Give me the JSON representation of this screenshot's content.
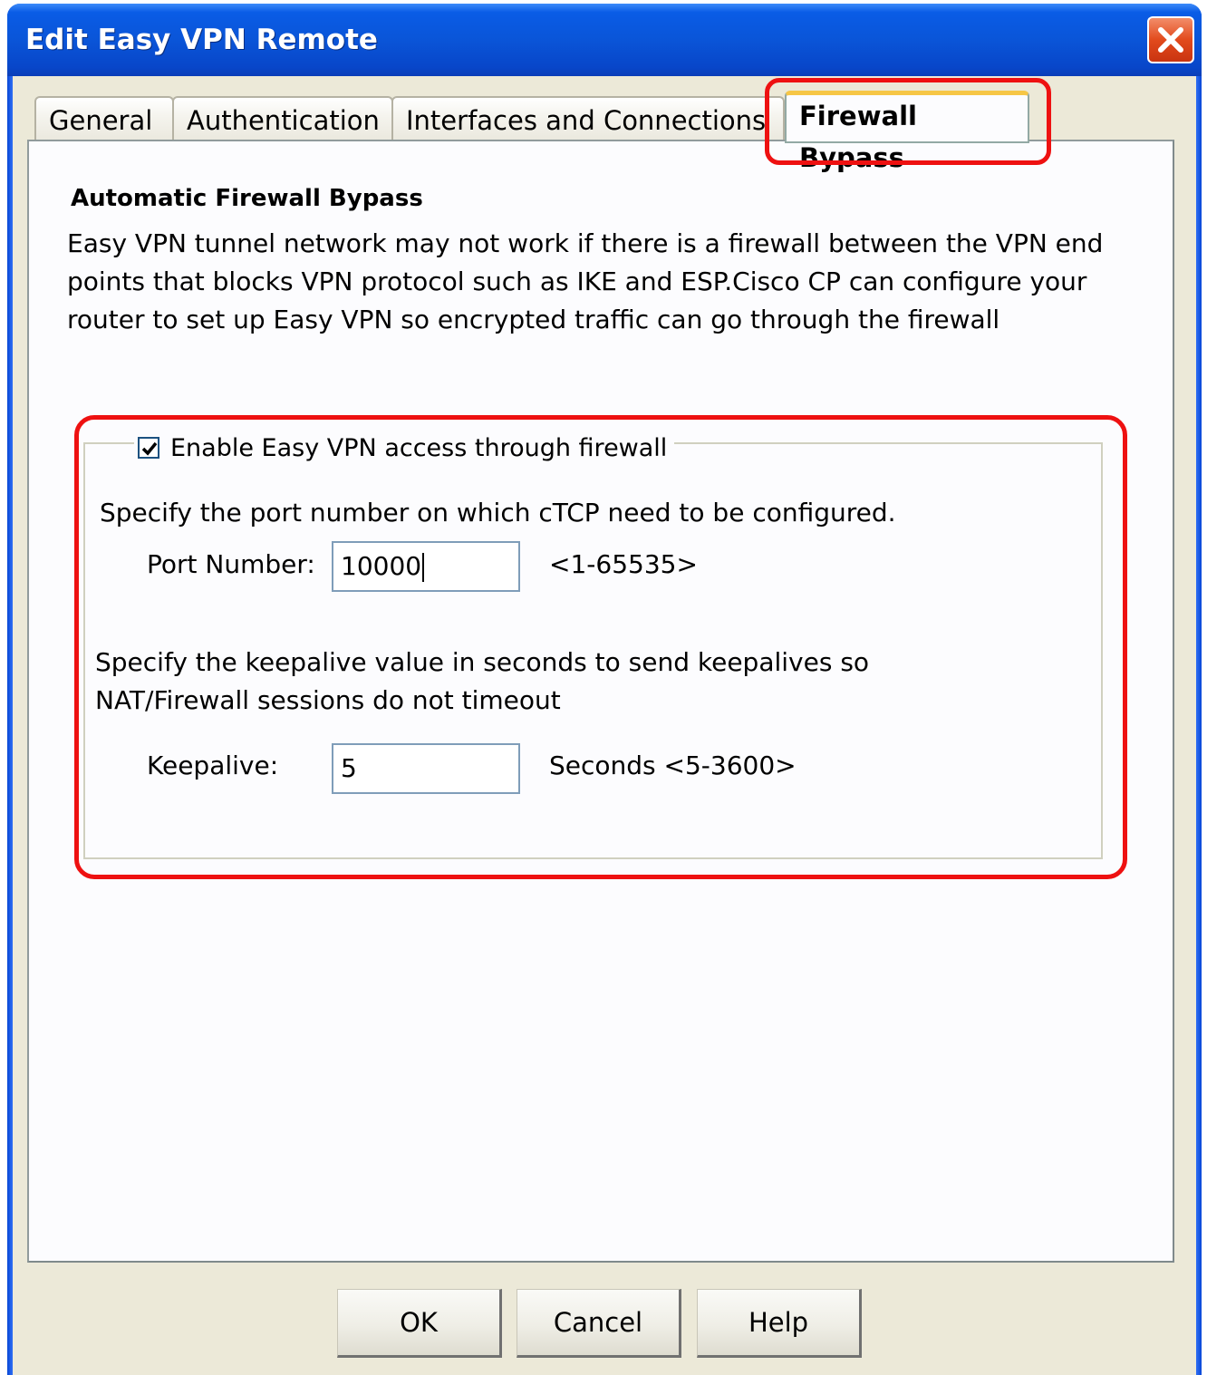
{
  "window": {
    "title": "Edit Easy VPN Remote",
    "close_icon": "close-icon"
  },
  "tabs": [
    {
      "label": "General"
    },
    {
      "label": "Authentication"
    },
    {
      "label": "Interfaces and Connections"
    },
    {
      "label": "Firewall Bypass",
      "active": true
    }
  ],
  "panel": {
    "section_title": "Automatic Firewall Bypass",
    "description": "Easy VPN tunnel network may not work if there is a firewall between the VPN end points that blocks VPN protocol such as IKE and ESP.Cisco CP can configure your router to set up Easy VPN so encrypted traffic can go through the firewall",
    "enable_checkbox": {
      "label": "Enable Easy VPN access through firewall",
      "checked": true,
      "icon": "checkmark-icon"
    },
    "port_instruction": "Specify the port number on which cTCP need to be configured.",
    "port_label": "Port Number:",
    "port_value": "10000",
    "port_range": "<1-65535>",
    "keepalive_instruction_line1": "Specify the keepalive value in seconds to send keepalives so",
    "keepalive_instruction_line2": "NAT/Firewall sessions do not timeout",
    "keepalive_label": "Keepalive:",
    "keepalive_value": "5",
    "keepalive_range": "Seconds <5-3600>"
  },
  "buttons": {
    "ok": "OK",
    "cancel": "Cancel",
    "help": "Help"
  },
  "colors": {
    "titlebar": "#0a55d8",
    "highlight": "#ee1111",
    "dialog_bg": "#ece9d8"
  }
}
